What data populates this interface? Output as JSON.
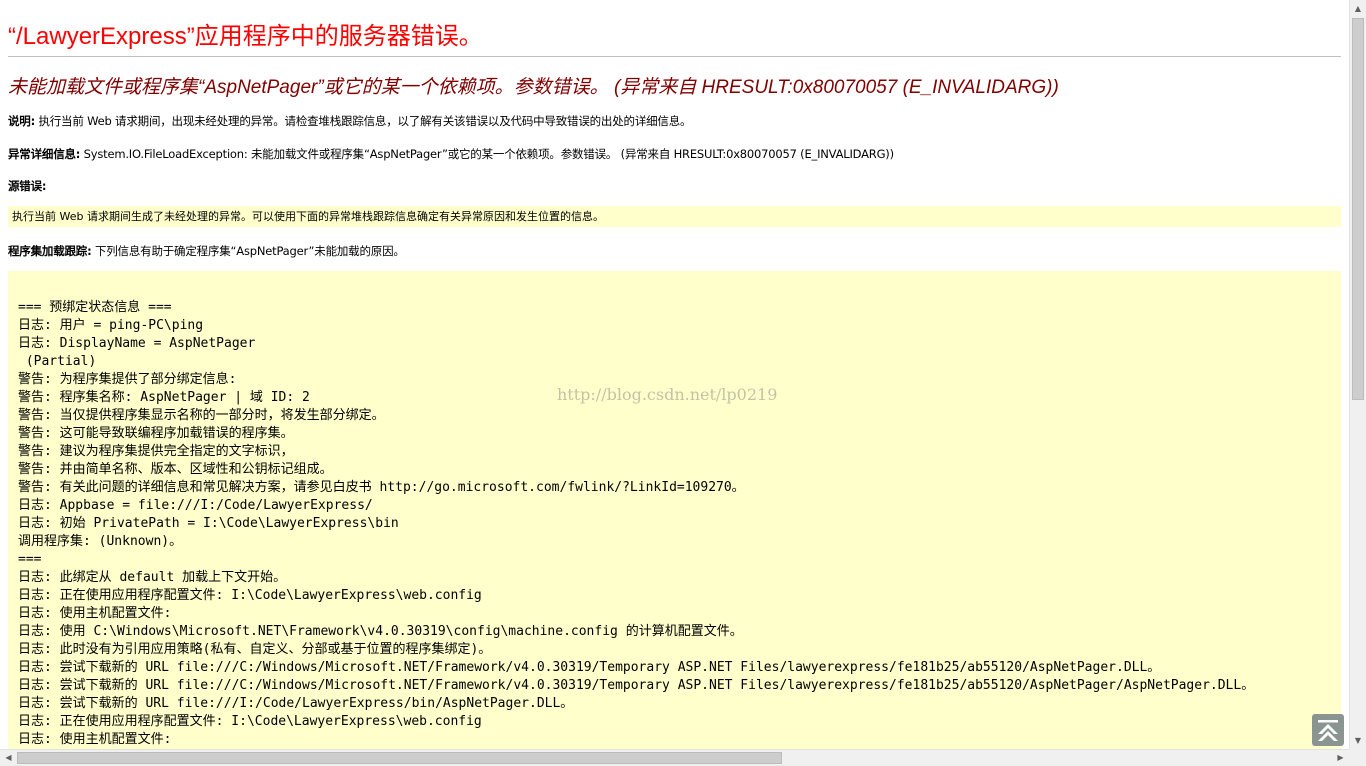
{
  "error_title": "“/LawyerExpress”应用程序中的服务器错误。",
  "error_heading": "未能加载文件或程序集“AspNetPager”或它的某一个依赖项。参数错误。 (异常来自 HRESULT:0x80070057 (E_INVALIDARG))",
  "description": {
    "label": "说明:",
    "text": " 执行当前 Web 请求期间，出现未经处理的异常。请检查堆栈跟踪信息，以了解有关该错误以及代码中导致错误的出处的详细信息。"
  },
  "exception_details": {
    "label": "异常详细信息:",
    "text": " System.IO.FileLoadException: 未能加载文件或程序集“AspNetPager”或它的某一个依赖项。参数错误。 (异常来自 HRESULT:0x80070057 (E_INVALIDARG))"
  },
  "source_error": {
    "label": "源错误:",
    "text": "执行当前 Web 请求期间生成了未经处理的异常。可以使用下面的异常堆栈跟踪信息确定有关异常原因和发生位置的信息。"
  },
  "assembly_trace": {
    "label": "程序集加载跟踪:",
    "text": " 下列信息有助于确定程序集“AspNetPager”未能加载的原因。"
  },
  "log_lines": [
    "=== 预绑定状态信息 ===",
    "日志: 用户 = ping-PC\\ping",
    "日志: DisplayName = AspNetPager",
    " (Partial)",
    "警告: 为程序集提供了部分绑定信息:",
    "警告: 程序集名称: AspNetPager | 域 ID: 2",
    "警告: 当仅提供程序集显示名称的一部分时，将发生部分绑定。",
    "警告: 这可能导致联编程序加载错误的程序集。",
    "警告: 建议为程序集提供完全指定的文字标识，",
    "警告: 并由简单名称、版本、区域性和公钥标记组成。",
    "警告: 有关此问题的详细信息和常见解决方案，请参见白皮书 http://go.microsoft.com/fwlink/?LinkId=109270。",
    "日志: Appbase = file:///I:/Code/LawyerExpress/",
    "日志: 初始 PrivatePath = I:\\Code\\LawyerExpress\\bin",
    "调用程序集: (Unknown)。",
    "===",
    "日志: 此绑定从 default 加载上下文开始。",
    "日志: 正在使用应用程序配置文件: I:\\Code\\LawyerExpress\\web.config",
    "日志: 使用主机配置文件:",
    "日志: 使用 C:\\Windows\\Microsoft.NET\\Framework\\v4.0.30319\\config\\machine.config 的计算机配置文件。",
    "日志: 此时没有为引用应用策略(私有、自定义、分部或基于位置的程序集绑定)。",
    "日志: 尝试下载新的 URL file:///C:/Windows/Microsoft.NET/Framework/v4.0.30319/Temporary ASP.NET Files/lawyerexpress/fe181b25/ab55120/AspNetPager.DLL。",
    "日志: 尝试下载新的 URL file:///C:/Windows/Microsoft.NET/Framework/v4.0.30319/Temporary ASP.NET Files/lawyerexpress/fe181b25/ab55120/AspNetPager/AspNetPager.DLL。",
    "日志: 尝试下载新的 URL file:///I:/Code/LawyerExpress/bin/AspNetPager.DLL。",
    "日志: 正在使用应用程序配置文件: I:\\Code\\LawyerExpress\\web.config",
    "日志: 使用主机配置文件:"
  ],
  "watermark": "http://blog.csdn.net/lp0219",
  "colors": {
    "title": "#ff0000",
    "heading": "#800000",
    "code_background": "#ffffcc"
  },
  "icons": {
    "back_to_top": "back-to-top-icon",
    "scroll_up": "scroll-up-arrow-icon",
    "scroll_down": "scroll-down-arrow-icon",
    "scroll_left": "scroll-left-arrow-icon",
    "scroll_right": "scroll-right-arrow-icon"
  }
}
